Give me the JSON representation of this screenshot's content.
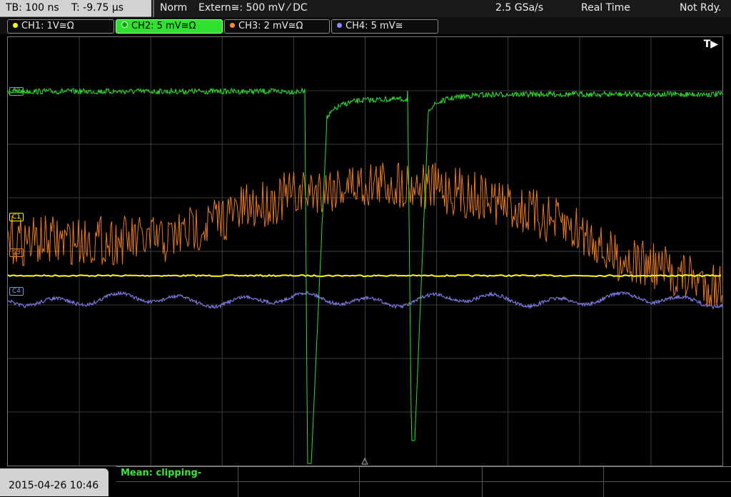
{
  "status_bar": {
    "timebase": "TB: 100 ns",
    "trigger_time": "T: -9.75 µs",
    "trigger_mode": "Norm",
    "trigger_source": "Extern≅: 500 mV ⁄ DC",
    "sample_rate": "2.5 GSa/s",
    "acq_mode": "Real Time",
    "status": "Not Rdy."
  },
  "channels": [
    {
      "label": "CH1: 1V≅Ω",
      "color": "#ffff00",
      "marker": "C1"
    },
    {
      "label": "CH2: 5 mV≅Ω",
      "color": "#2fe02f",
      "marker": "C2"
    },
    {
      "label": "CH3: 2 mV≅Ω",
      "color": "#ff8a2a",
      "marker": "C3"
    },
    {
      "label": "CH4: 5 mV≅",
      "color": "#8a8aff",
      "marker": "C4"
    }
  ],
  "trigger_indicator": "T▶",
  "bottom": {
    "date": "2015-04-26 10:46",
    "measurement": "Mean: clipping-"
  },
  "colors": {
    "grid": "#3c3c3c",
    "ch1": "#ffff00",
    "ch2": "#2fe02f",
    "ch3": "#e87a24",
    "ch4": "#7a78e0"
  }
}
